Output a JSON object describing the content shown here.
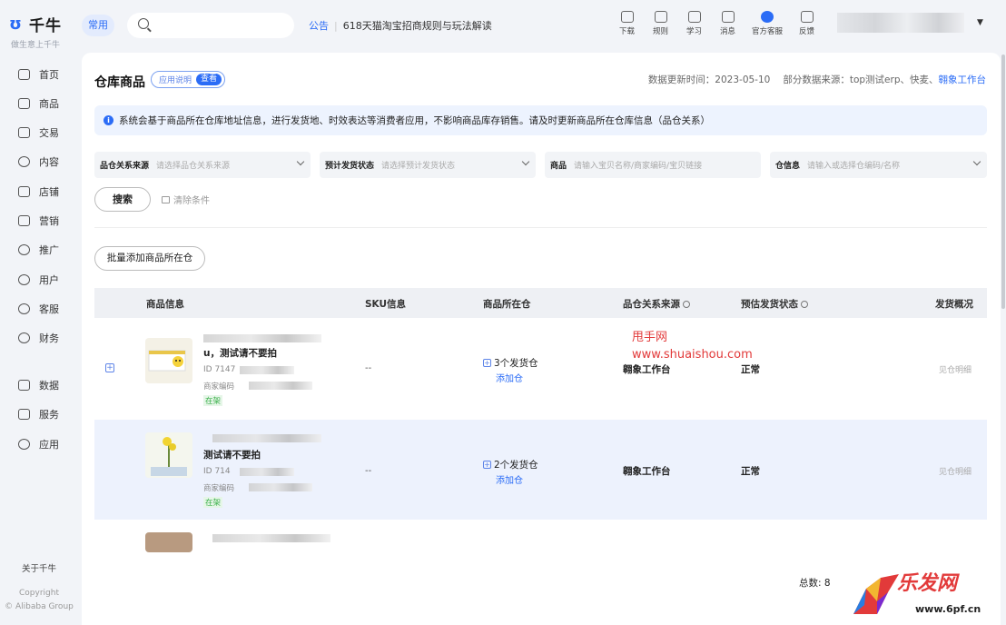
{
  "app": {
    "name": "千牛",
    "slogan": "做生意上千牛",
    "logo_icon": "qianniu-logo-icon"
  },
  "header": {
    "common_tag": "常用",
    "search_placeholder": "",
    "notice_label": "公告",
    "notice_text": "618天猫淘宝招商规则与玩法解读",
    "icons": [
      {
        "label": "下载",
        "icon": "download-icon"
      },
      {
        "label": "规则",
        "icon": "rules-icon"
      },
      {
        "label": "学习",
        "icon": "learn-icon"
      },
      {
        "label": "消息",
        "icon": "message-icon"
      },
      {
        "label": "官方客服",
        "icon": "service-icon"
      },
      {
        "label": "反馈",
        "icon": "feedback-icon"
      }
    ]
  },
  "sidebar": {
    "items": [
      {
        "label": "首页",
        "icon": "home-icon"
      },
      {
        "label": "商品",
        "icon": "goods-icon"
      },
      {
        "label": "交易",
        "icon": "trade-icon"
      },
      {
        "label": "内容",
        "icon": "content-icon"
      },
      {
        "label": "店铺",
        "icon": "shop-icon"
      },
      {
        "label": "营销",
        "icon": "marketing-icon"
      },
      {
        "label": "推广",
        "icon": "promotion-icon"
      },
      {
        "label": "用户",
        "icon": "user-icon"
      },
      {
        "label": "客服",
        "icon": "support-icon"
      },
      {
        "label": "财务",
        "icon": "finance-icon"
      },
      {
        "label": "数据",
        "icon": "data-icon"
      },
      {
        "label": "服务",
        "icon": "services-icon"
      },
      {
        "label": "应用",
        "icon": "apps-icon"
      }
    ],
    "about": "关于千牛",
    "copyright": "Copyright",
    "company": "© Alibaba Group"
  },
  "page": {
    "title": "仓库商品",
    "help_label": "应用说明",
    "help_view": "查看",
    "update_time": "数据更新时间：2023-05-10",
    "data_source": "部分数据来源：top测试erp、快麦、",
    "data_source_link": "翱象工作台",
    "alert": "系统会基于商品所在仓库地址信息，进行发货地、时效表达等消费者应用，不影响商品库存销售。请及时更新商品所在仓库信息（品仓关系）"
  },
  "filters": [
    {
      "label": "品仓关系来源",
      "placeholder": "请选择品仓关系来源"
    },
    {
      "label": "预计发货状态",
      "placeholder": "请选择预计发货状态"
    },
    {
      "label": "商品",
      "placeholder": "请输入宝贝名称/商家编码/宝贝链接"
    },
    {
      "label": "仓信息",
      "placeholder": "请输入或选择仓编码/名称"
    }
  ],
  "actions": {
    "search": "搜索",
    "clear": "清除条件",
    "batch_add": "批量添加商品所在仓"
  },
  "table": {
    "headers": [
      "商品信息",
      "SKU信息",
      "商品所在仓",
      "品仓关系来源",
      "预估发货状态",
      "发货概况"
    ],
    "rows": [
      {
        "name": "u，测试请不要拍",
        "id": "ID 7147",
        "code": "商家编码",
        "status": "在架",
        "sku": "--",
        "warehouse": "3个发货仓",
        "add": "添加仓",
        "source": "翱象工作台",
        "ship_status": "正常",
        "detail": "见仓明细"
      },
      {
        "name": "测试请不要拍",
        "id": "ID 714",
        "code": "商家编码",
        "status": "在架",
        "sku": "--",
        "warehouse": "2个发货仓",
        "add": "添加仓",
        "source": "翱象工作台",
        "ship_status": "正常",
        "detail": "见仓明细"
      }
    ]
  },
  "watermark": {
    "line1": "甩手网",
    "line2": "www.shuaishou.com",
    "corner_title": "乐发网",
    "corner_url": "www.6pf.cn"
  },
  "footer": {
    "total": "总数: 8"
  },
  "colors": {
    "accent": "#2b6cf6",
    "success": "#3bb04a",
    "watermark": "#e23a3a"
  }
}
